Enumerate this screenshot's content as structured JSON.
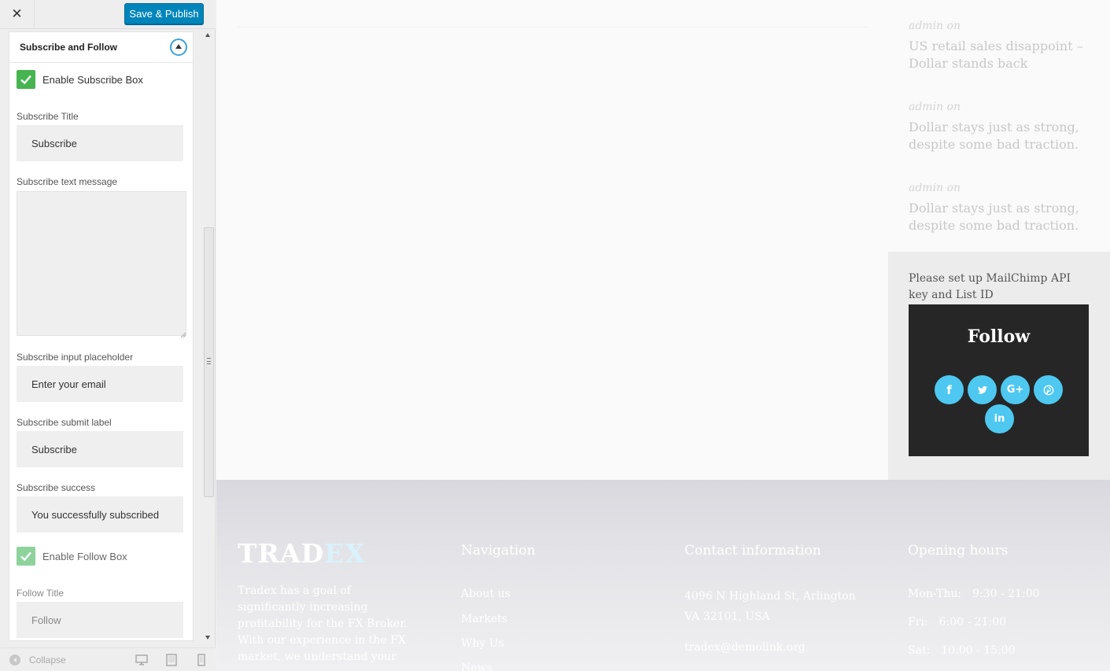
{
  "topbar": {
    "close_glyph": "✕",
    "save_label": "Save & Publish",
    "accent": "#0085ba"
  },
  "section": {
    "title": "Subscribe and Follow"
  },
  "fields": {
    "enable_subscribe": {
      "label": "Enable Subscribe Box",
      "checked": true
    },
    "subscribe_title": {
      "label": "Subscribe Title",
      "value": "Subscribe"
    },
    "subscribe_message": {
      "label": "Subscribe text message",
      "value": ""
    },
    "subscribe_placeholder": {
      "label": "Subscribe input placeholder",
      "value": "Enter your email"
    },
    "subscribe_submit": {
      "label": "Subscribe submit label",
      "value": "Subscribe"
    },
    "subscribe_success": {
      "label": "Subscribe success",
      "value": "You successfully subscribed"
    },
    "enable_follow": {
      "label": "Enable Follow Box",
      "checked": true
    },
    "follow_title": {
      "label": "Follow Title",
      "value": "Follow"
    }
  },
  "footer_bar": {
    "collapse_label": "Collapse",
    "devices": [
      "desktop-icon",
      "tablet-icon",
      "mobile-icon"
    ]
  },
  "preview": {
    "posts": [
      {
        "meta": "admin on",
        "title": "US retail sales disappoint – Dollar stands back"
      },
      {
        "meta": "admin on",
        "title": "Dollar stays just as strong, despite some bad traction."
      },
      {
        "meta": "admin on",
        "title": "Dollar stays just as strong, despite some bad traction."
      }
    ],
    "mailchimp_note": "Please set up MailChimp API key and List ID",
    "follow_title": "Follow",
    "social": [
      {
        "icon": "facebook-icon",
        "glyph": "f"
      },
      {
        "icon": "twitter-icon",
        "glyph": "🐦"
      },
      {
        "icon": "google-plus-icon",
        "glyph": "G+"
      },
      {
        "icon": "pinterest-icon",
        "glyph": "℗"
      },
      {
        "icon": "linkedin-icon",
        "glyph": "in"
      }
    ],
    "social_color": "#4ec8f0",
    "footer": {
      "logo_part1": "TRAD",
      "logo_part2": "EX",
      "about": "Tradex has a goal of significantly increasing profitability for the FX Broker. With our experience in the FX market, we understand your",
      "nav_heading": "Navigation",
      "nav_links": [
        "About us",
        "Markets",
        "Why Us",
        "News"
      ],
      "contact_heading": "Contact information",
      "address_line1": "4096 N Highland St, Arlington",
      "address_line2": "VA 32101, USA",
      "email": "tradex@demolink.org",
      "hours_heading": "Opening hours",
      "hours": [
        {
          "day": "Mon-Thu:",
          "time": "9:30 - 21:00"
        },
        {
          "day": "Fri:",
          "time": "6:00 - 21:00"
        },
        {
          "day": "Sat:",
          "time": "10:00 - 15:00"
        }
      ]
    }
  }
}
